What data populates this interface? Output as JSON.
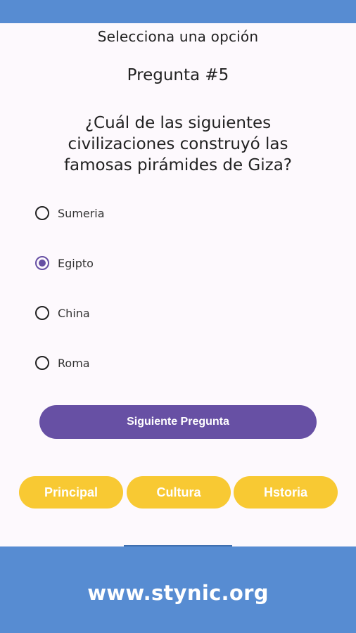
{
  "header": {
    "title": "Selecciona una opción"
  },
  "question": {
    "number": "Pregunta #5",
    "text": "¿Cuál de las siguientes civilizaciones construyó las famosas pirámides de Giza?"
  },
  "options": [
    {
      "label": "Sumeria",
      "selected": false
    },
    {
      "label": "Egipto",
      "selected": true
    },
    {
      "label": "China",
      "selected": false
    },
    {
      "label": "Roma",
      "selected": false
    }
  ],
  "next_button": {
    "label": "Siguiente Pregunta"
  },
  "categories": [
    {
      "label": "Principal"
    },
    {
      "label": "Cultura"
    },
    {
      "label": "Hstoria"
    }
  ],
  "footer": {
    "url": "www.stynic.org"
  },
  "colors": {
    "brand_blue": "#578cd2",
    "accent_purple": "#6750a4",
    "category_yellow": "#f8c933",
    "background": "#fdf9fd"
  }
}
